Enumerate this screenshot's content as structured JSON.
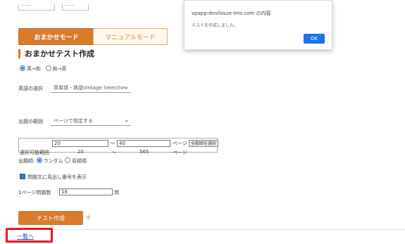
{
  "top_controls": [
    {
      "text": "——"
    },
    {
      "text": "——"
    }
  ],
  "modes": {
    "auto": "おまかせモード",
    "manual": "マニュアルモード"
  },
  "section_title": "おまかせテスト作成",
  "language": {
    "options": [
      "英→和",
      "和→英"
    ],
    "selected": 0
  },
  "word_select": {
    "label": "英語の選択",
    "value": "英単語・熟語Vintage Selection"
  },
  "range_select": {
    "label": "出題の範囲",
    "value": "ページで指定する"
  },
  "range": {
    "from": "20",
    "to": "40",
    "unit": "ページ",
    "button": "全範囲を選択"
  },
  "selectable": {
    "label": "選択可能範囲",
    "min": "20",
    "sep": "〜",
    "max": "565",
    "unit": "ページ"
  },
  "order": {
    "label": "出題順",
    "options": [
      "ランダム",
      "収録順"
    ],
    "selected": 0
  },
  "show_number": {
    "label": "問題文に見出し番号を表示",
    "checked": true
  },
  "count": {
    "label": "1ページ問題数",
    "value": "16",
    "unit": "問"
  },
  "create_button": "テスト作成",
  "back_link": "一覧へ",
  "dialog": {
    "host": "vpapp-devlissue-lms.com の内容",
    "message": "テストを作成しました。",
    "ok": "OK"
  }
}
